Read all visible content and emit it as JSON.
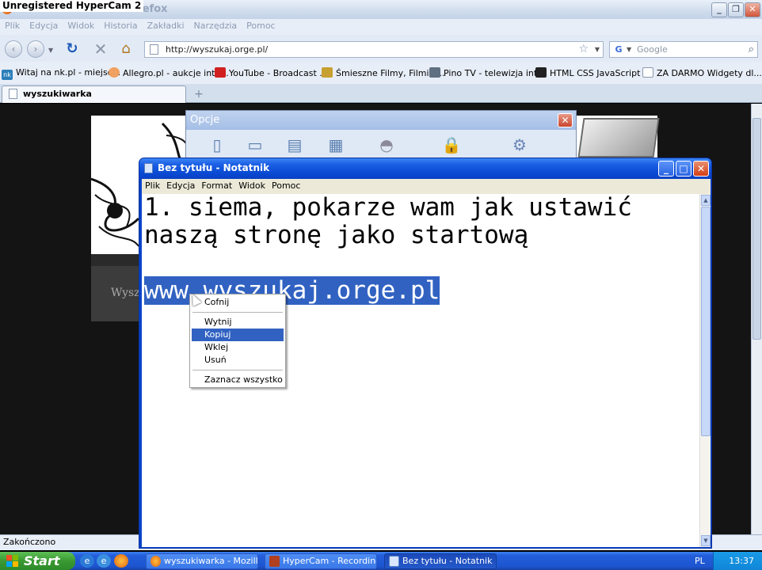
{
  "recorder_banner": "Unregistered HyperCam 2",
  "browser": {
    "title_suffix": "Firefox",
    "menu": [
      "Plik",
      "Edycja",
      "Widok",
      "Historia",
      "Zakładki",
      "Narzędzia",
      "Pomoc"
    ],
    "url": "http://wyszukaj.orge.pl/",
    "search_placeholder": "Google",
    "bookmarks": [
      "Witaj na nk.pl - miejsc...",
      "Allegro.pl - aukcje inte...",
      "YouTube - Broadcast ...",
      "Śmieszne Filmy, Filmiki...",
      "Pino TV - telewizja int...",
      "HTML CSS JavaScript ...",
      "ZA DARMO Widgety dl..."
    ],
    "tab_title": "wyszukiwarka",
    "page_text": "Wysz",
    "status": "Zakończono"
  },
  "options_dialog": {
    "title": "Opcje"
  },
  "notepad": {
    "title": "Bez tytułu - Notatnik",
    "menu": [
      "Plik",
      "Edycja",
      "Format",
      "Widok",
      "Pomoc"
    ],
    "line1": "1. siema, pokarze wam jak ustawić",
    "line2": "naszą stronę jako startową",
    "selected_line": "www.wyszukaj.orge.pl"
  },
  "context_menu": {
    "items": [
      "Cofnij",
      "Wytnij",
      "Kopiuj",
      "Wklej",
      "Usuń",
      "Zaznacz wszystko"
    ],
    "highlighted": "Kopiuj"
  },
  "taskbar": {
    "start_label": "Start",
    "tasks": [
      "wyszukiwarka - Mozill...",
      "HyperCam - Recording",
      "Bez tytułu - Notatnik"
    ],
    "active_task": "Bez tytułu - Notatnik",
    "language": "PL",
    "clock": "13:37"
  },
  "colors": {
    "xp_blue": "#0a44c8",
    "selection": "#3162c2",
    "start_green": "#3a9a33"
  }
}
